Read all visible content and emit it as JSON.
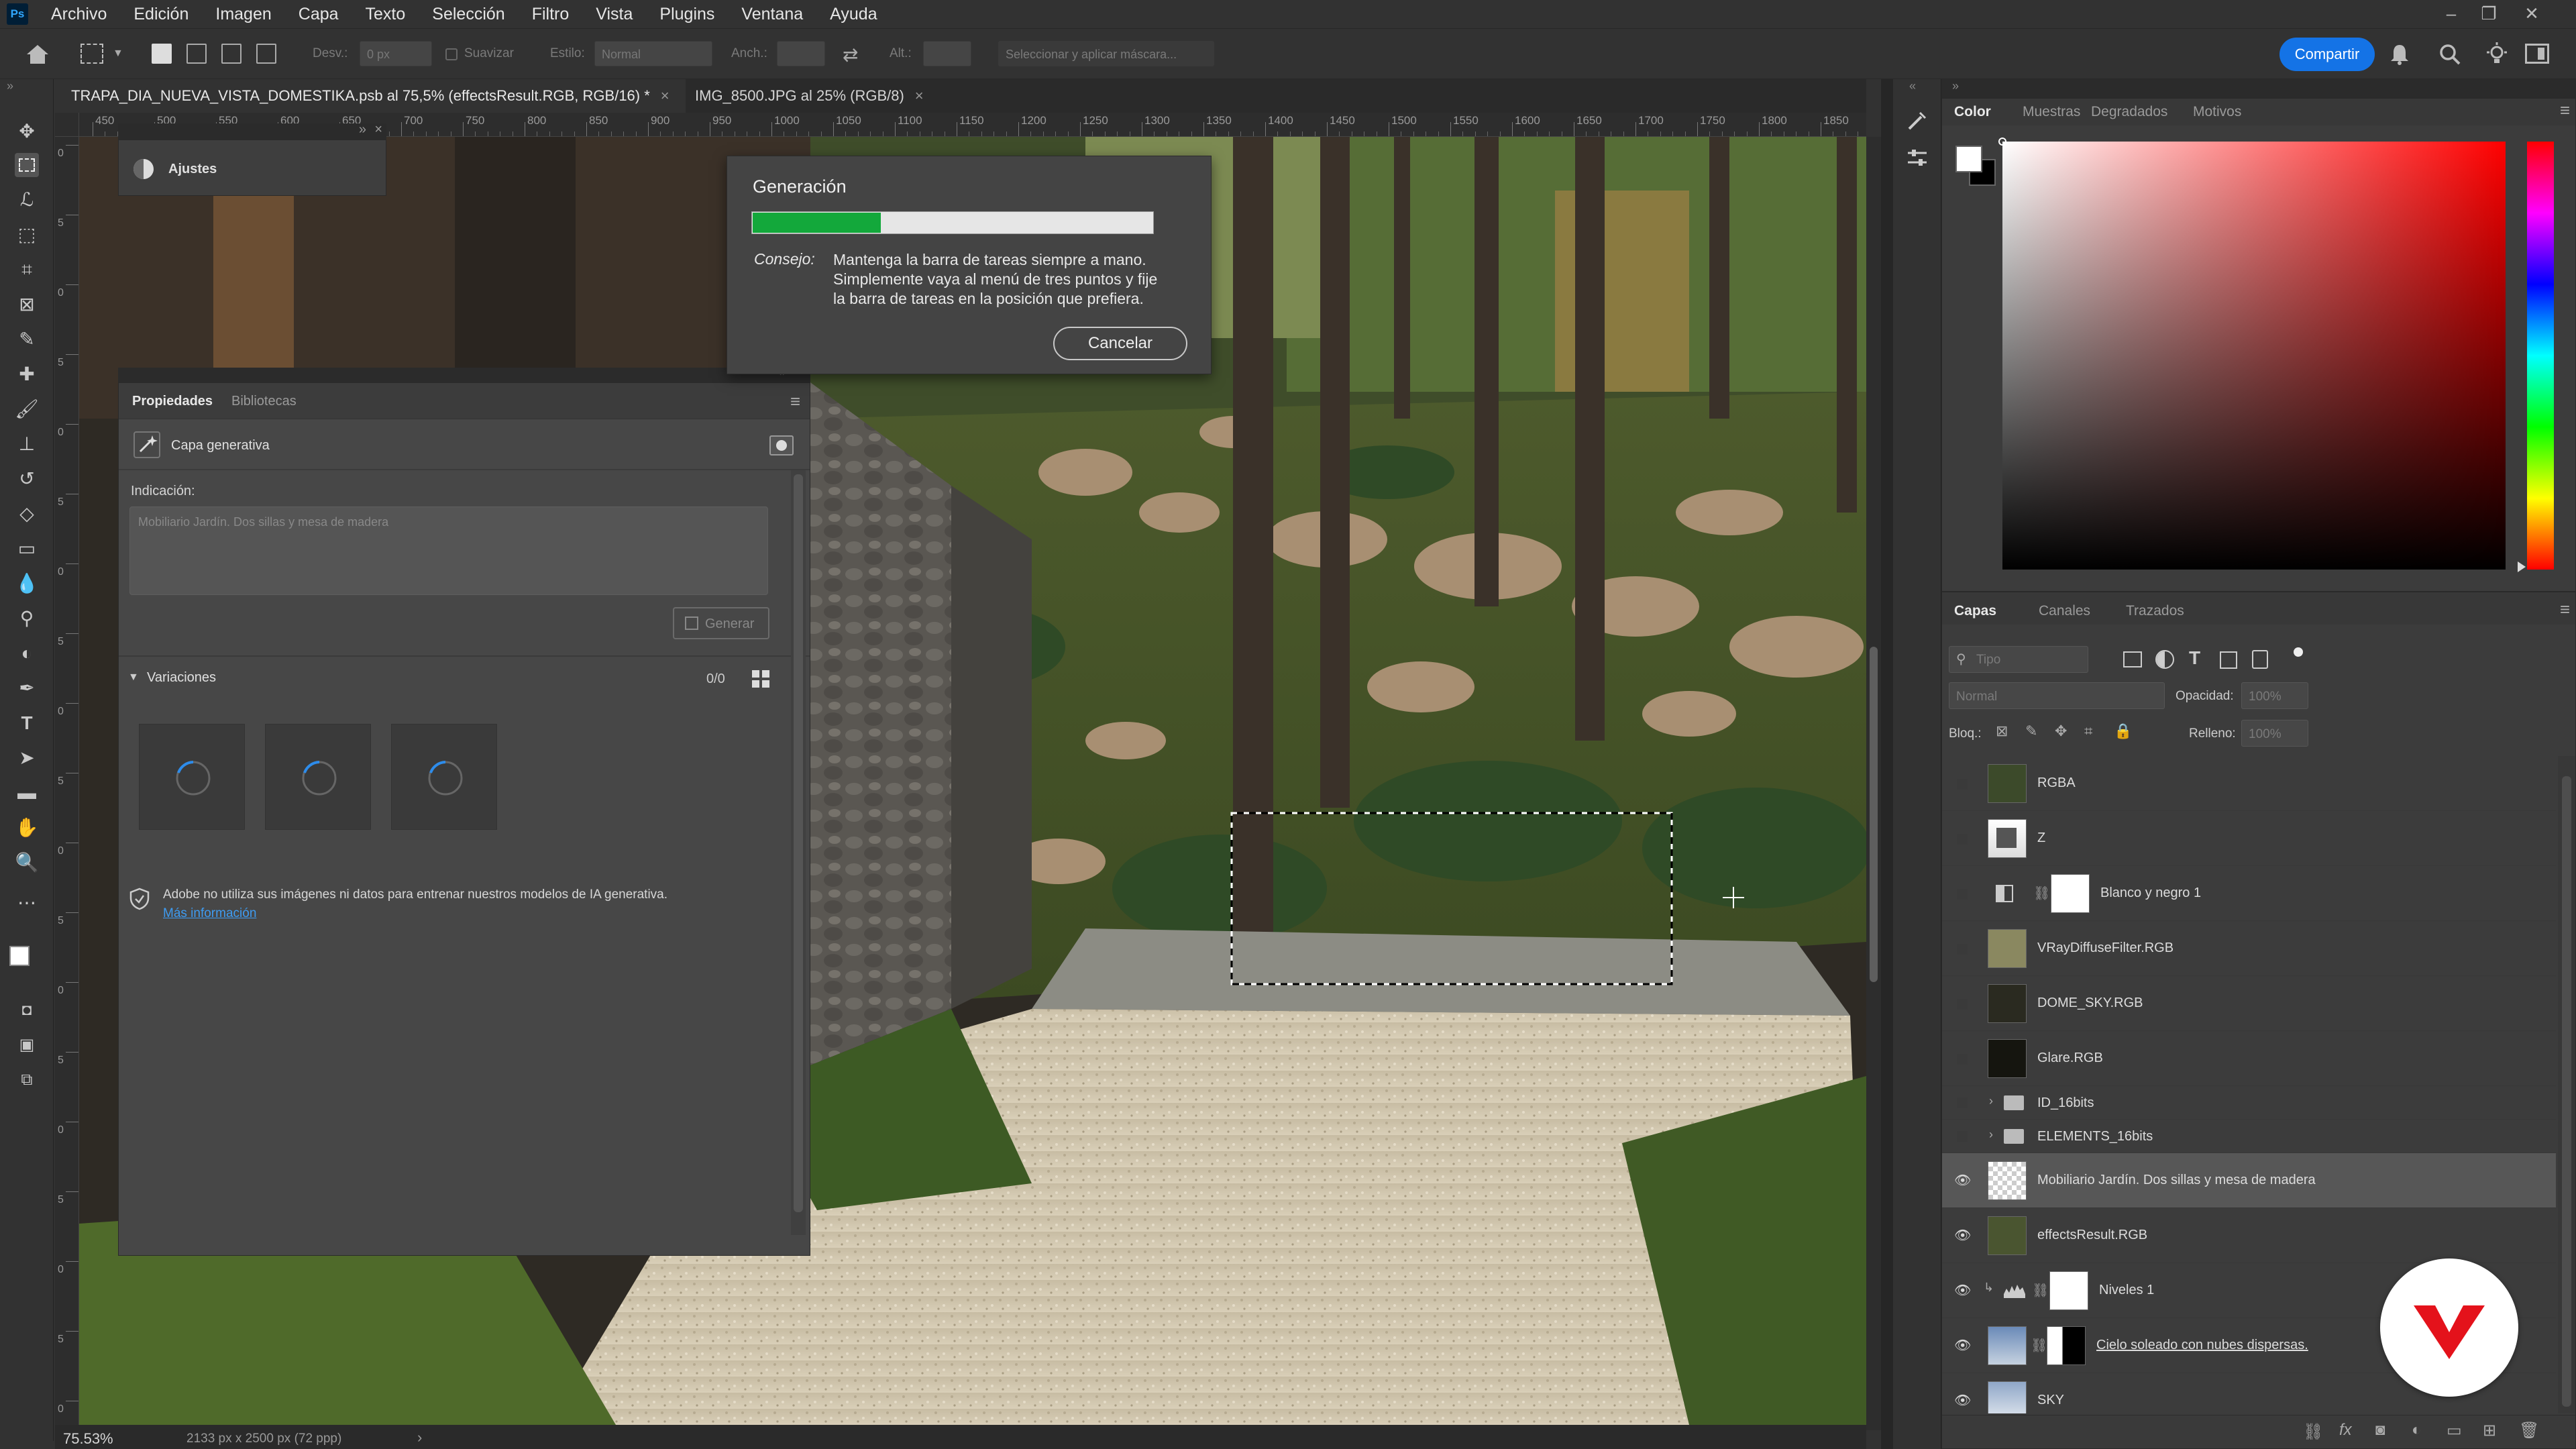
{
  "menu": {
    "logo": "Ps",
    "items": [
      "Archivo",
      "Edición",
      "Imagen",
      "Capa",
      "Texto",
      "Selección",
      "Filtro",
      "Vista",
      "Plugins",
      "Ventana",
      "Ayuda"
    ]
  },
  "window_controls": {
    "minimize": "–",
    "restore": "❐",
    "close": "✕"
  },
  "options_bar": {
    "desv_label": "Desv.:",
    "desv_value": "0 px",
    "suavizar_label": "Suavizar",
    "estilo_label": "Estilo:",
    "estilo_value": "Normal",
    "anch_label": "Anch.:",
    "alt_label": "Alt.:",
    "mask_button": "Seleccionar y aplicar máscara...",
    "share": "Compartir"
  },
  "tabs": [
    {
      "label": "TRAPA_DIA_NUEVA_VISTA_DOMESTIKA.psb al 75,5% (effectsResult.RGB, RGB/16) *",
      "close": "×"
    },
    {
      "label": "IMG_8500.JPG al 25% (RGB/8)",
      "close": "×"
    }
  ],
  "ruler": {
    "ticks": [
      "450",
      "500",
      "550",
      "600",
      "650",
      "700",
      "750",
      "800",
      "850",
      "900",
      "950",
      "1000",
      "1050",
      "1100",
      "1150",
      "1200",
      "1250",
      "1300",
      "1350",
      "1400",
      "1450",
      "1500",
      "1550",
      "1600",
      "1650",
      "1700",
      "1750",
      "1800",
      "1850"
    ],
    "vticks": [
      "0",
      "5",
      "0",
      "5",
      "0",
      "5",
      "0",
      "5",
      "0",
      "5",
      "0",
      "5",
      "0",
      "5",
      "0",
      "5",
      "0",
      "5",
      "0"
    ]
  },
  "status": {
    "zoom": "75.53%",
    "size": "2133 px x 2500 px (72 ppp)",
    "arrow": "›"
  },
  "ajustes": {
    "title": "Ajustes"
  },
  "properties": {
    "tabs": [
      "Propiedades",
      "Bibliotecas"
    ],
    "layer_type": "Capa generativa",
    "prompt_label": "Indicación:",
    "prompt_value": "Mobiliario Jardín. Dos sillas y mesa de madera",
    "generate": "Generar",
    "variations_label": "Variaciones",
    "variations_count": "0/0",
    "notice": "Adobe no utiliza sus imágenes ni datos para entrenar nuestros modelos de IA generativa.",
    "more_info": "Más información"
  },
  "generation_dialog": {
    "title": "Generación",
    "progress": 0.32,
    "tip_label": "Consejo:",
    "tip_lines": [
      "Mantenga la barra de tareas siempre a mano.",
      "Simplemente vaya al menú de tres puntos y fije",
      "la barra de tareas en la posición que prefiera."
    ],
    "cancel": "Cancelar"
  },
  "color_panel": {
    "tabs": [
      "Color",
      "Muestras",
      "Degradados",
      "Motivos"
    ],
    "fg": "#ffffff",
    "bg": "#000000",
    "hue": "#ff0000"
  },
  "layers_panel": {
    "tabs": [
      "Capas",
      "Canales",
      "Trazados"
    ],
    "search_placeholder": "Tipo",
    "blend_mode": "Normal",
    "opacity_label": "Opacidad:",
    "opacity_value": "100%",
    "lock_label": "Bloq.:",
    "fill_label": "Relleno:",
    "fill_value": "100%",
    "layers": [
      {
        "name": "RGBA",
        "visible": false
      },
      {
        "name": "Z",
        "visible": false
      },
      {
        "name": "Blanco y negro 1",
        "visible": false
      },
      {
        "name": "VRayDiffuseFilter.RGB",
        "visible": false
      },
      {
        "name": "DOME_SKY.RGB",
        "visible": false
      },
      {
        "name": "Glare.RGB",
        "visible": false
      },
      {
        "name": "ID_16bits",
        "visible": false
      },
      {
        "name": "ELEMENTS_16bits",
        "visible": false
      },
      {
        "name": "Mobiliario Jardín. Dos sillas y mesa de madera",
        "visible": true
      },
      {
        "name": "effectsResult.RGB",
        "visible": true
      },
      {
        "name": "Niveles 1",
        "visible": true
      },
      {
        "name": "Cielo soleado con nubes dispersas.",
        "visible": true
      },
      {
        "name": "SKY",
        "visible": true
      }
    ]
  }
}
